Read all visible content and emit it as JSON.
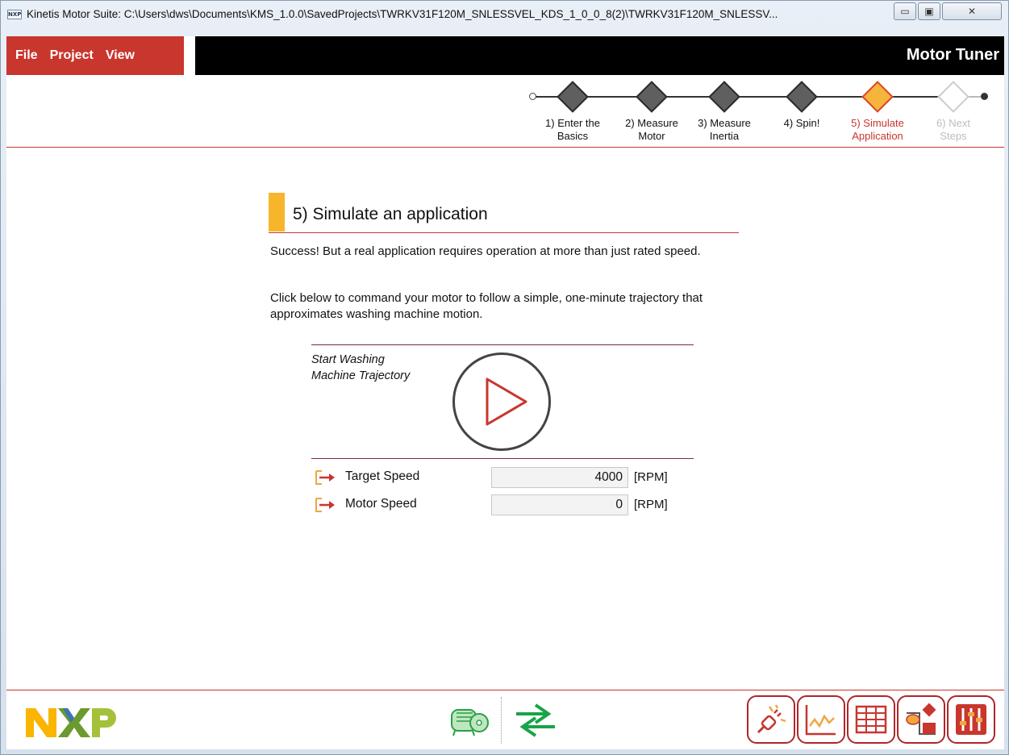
{
  "window": {
    "icon_text": "NXP",
    "title": "Kinetis Motor Suite: C:\\Users\\dws\\Documents\\KMS_1.0.0\\SavedProjects\\TWRKV31F120M_SNLESSVEL_KDS_1_0_0_8(2)\\TWRKV31F120M_SNLESSV...",
    "minimize": "▭",
    "maximize": "▣",
    "close": "✕"
  },
  "menu": {
    "file": "File",
    "project": "Project",
    "view": "View",
    "app_name": "Motor Tuner"
  },
  "steps": [
    {
      "line1": "1) Enter the",
      "line2": "Basics",
      "state": "done"
    },
    {
      "line1": "2) Measure",
      "line2": "Motor",
      "state": "done"
    },
    {
      "line1": "3) Measure",
      "line2": "Inertia",
      "state": "done"
    },
    {
      "line1": "4) Spin!",
      "line2": "",
      "state": "done"
    },
    {
      "line1": "5) Simulate",
      "line2": "Application",
      "state": "active"
    },
    {
      "line1": "6) Next",
      "line2": "Steps",
      "state": "future"
    }
  ],
  "colors": {
    "active_step_text": "#c8362e",
    "future_step_text": "#bdbdbd",
    "done_step_text": "#111111",
    "accent": "#c8362e",
    "section_bar": "#f7b52b"
  },
  "main": {
    "title": "5) Simulate an application",
    "para1": "Success! But a real application requires operation at more than just rated speed.",
    "para2": "Click below to command your motor to follow a simple, one-minute trajectory that approximates washing machine motion.",
    "trajectory_label_1": "Start Washing",
    "trajectory_label_2": "Machine Trajectory"
  },
  "fields": [
    {
      "label": "Target Speed",
      "value": "4000",
      "unit": "[RPM]"
    },
    {
      "label": "Motor Speed",
      "value": "0",
      "unit": "[RPM]"
    }
  ],
  "footer": {
    "logo_text": "NXP",
    "tools": [
      "connect-icon",
      "scope-icon",
      "table-icon",
      "control-diagram-icon",
      "tuning-icon"
    ]
  }
}
